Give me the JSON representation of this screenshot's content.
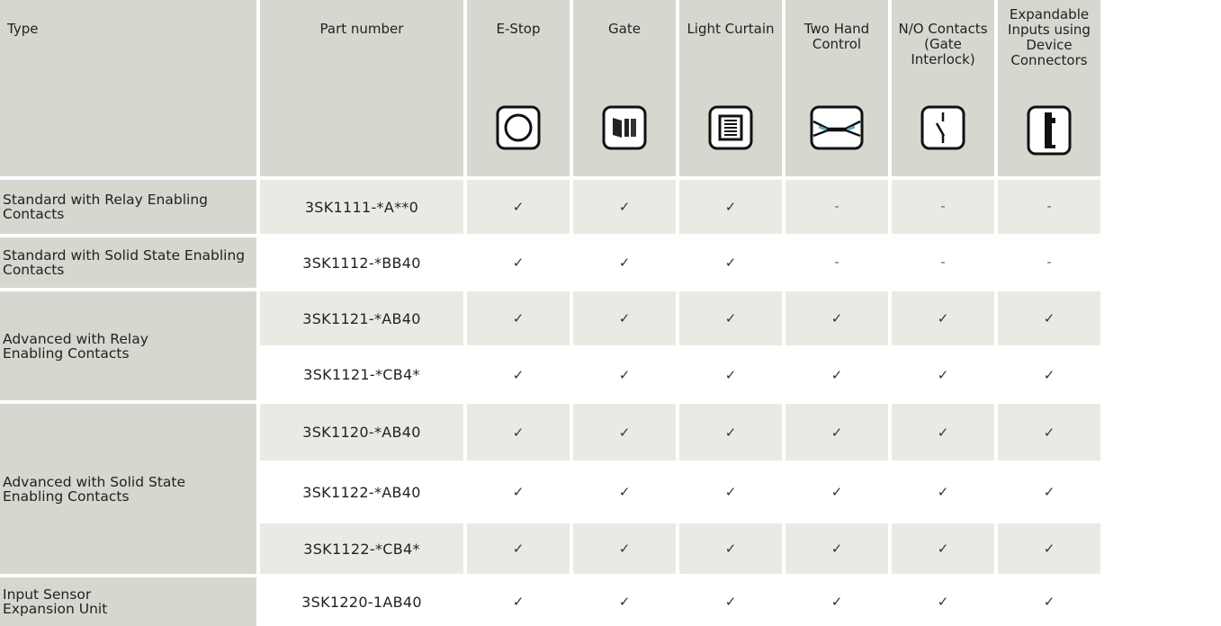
{
  "headers": {
    "type": "Type",
    "part_number": "Part number",
    "columns": [
      {
        "label": "E-Stop",
        "icon": "e-stop-circle-icon"
      },
      {
        "label": "Gate",
        "icon": "gate-door-icon"
      },
      {
        "label": "Light Curtain",
        "icon": "light-curtain-icon"
      },
      {
        "label": "Two Hand Control",
        "icon": "two-hand-control-icon"
      },
      {
        "label": "N/O Contacts (Gate Interlock)",
        "icon": "no-contact-switch-icon"
      },
      {
        "label": "Expandable Inputs using Device Connectors",
        "icon": "device-connector-icon"
      }
    ]
  },
  "groups": [
    {
      "type": "Standard with Relay Enabling Contacts"
    },
    {
      "type": "Standard with Solid State Enabling Contacts"
    },
    {
      "type": "Advanced with Relay Enabling Contacts"
    },
    {
      "type": "Advanced with Solid State Enabling Contacts"
    },
    {
      "type": "Input Sensor Expansion Unit"
    }
  ],
  "rows": [
    {
      "part": "3SK1111-*A**0",
      "values": [
        "✓",
        "✓",
        "✓",
        "-",
        "-",
        "-"
      ]
    },
    {
      "part": "3SK1112-*BB40",
      "values": [
        "✓",
        "✓",
        "✓",
        "-",
        "-",
        "-"
      ]
    },
    {
      "part": "3SK1121-*AB40",
      "values": [
        "✓",
        "✓",
        "✓",
        "✓",
        "✓",
        "✓"
      ]
    },
    {
      "part": "3SK1121-*CB4*",
      "values": [
        "✓",
        "✓",
        "✓",
        "✓",
        "✓",
        "✓"
      ]
    },
    {
      "part": "3SK1120-*AB40",
      "values": [
        "✓",
        "✓",
        "✓",
        "✓",
        "✓",
        "✓"
      ]
    },
    {
      "part": "3SK1122-*AB40",
      "values": [
        "✓",
        "✓",
        "✓",
        "✓",
        "✓",
        "✓"
      ]
    },
    {
      "part": "3SK1122-*CB4*",
      "values": [
        "✓",
        "✓",
        "✓",
        "✓",
        "✓",
        "✓"
      ]
    },
    {
      "part": "3SK1220-1AB40",
      "values": [
        "✓",
        "✓",
        "✓",
        "✓",
        "✓",
        "✓"
      ]
    }
  ]
}
